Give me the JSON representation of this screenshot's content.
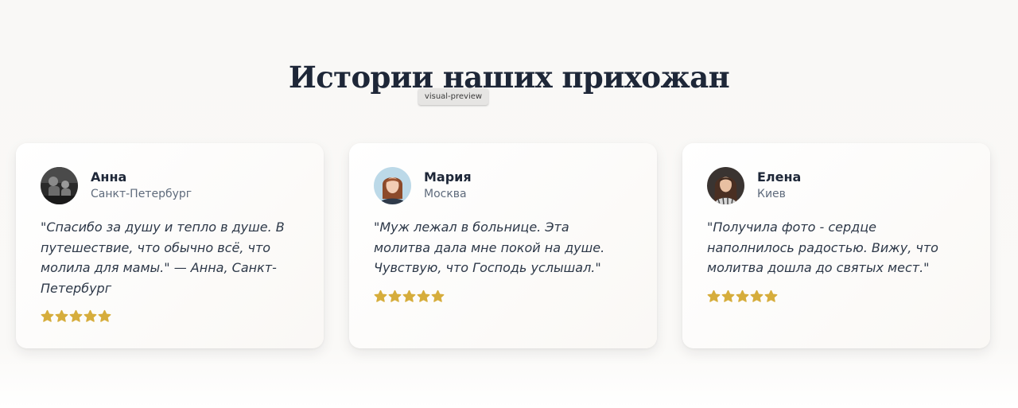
{
  "section": {
    "title": "Истории наших прихожан",
    "preview_badge": "visual-preview"
  },
  "testimonials": [
    {
      "name": "Анна",
      "city": "Санкт-Петербург",
      "quote": "\"Спасибо за душу и тепло в душе. В путешествие, что обычно всё, что молила для мамы.\" — Анна, Санкт-Петербург",
      "rating": 5,
      "avatar_icon": "avatar-photo-dark"
    },
    {
      "name": "Мария",
      "city": "Москва",
      "quote": "\"Муж лежал в больнице. Эта молитва дала мне покой на душе. Чувствую, что Господь услышал.\"",
      "rating": 5,
      "avatar_icon": "avatar-photo-light"
    },
    {
      "name": "Елена",
      "city": "Киев",
      "quote": "\"Получила фото - сердце наполнилось радостью. Вижу, что молитва дошла до святых мест.\"",
      "rating": 5,
      "avatar_icon": "avatar-photo-woman"
    }
  ],
  "colors": {
    "star": "#d6ad3c",
    "title": "#1e2738",
    "muted": "#5f6b7c"
  }
}
